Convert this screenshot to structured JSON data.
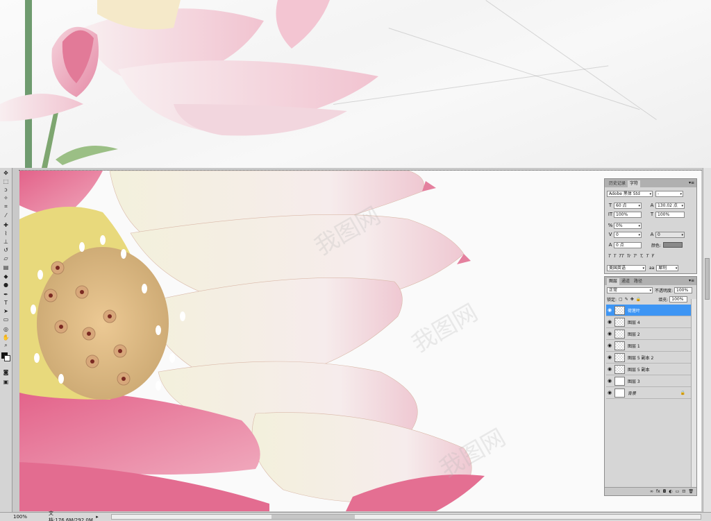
{
  "colors": {
    "selection": "#3d95f4",
    "panel": "#d6d6d6",
    "petal_pink": "#e97a9c",
    "stamen": "#e6cf3c"
  },
  "character_panel": {
    "tabs": [
      "历史记录",
      "字符"
    ],
    "font_family": "Adobe 黑体 Std",
    "font_style": "-",
    "font_size": "60 点",
    "leading": "130.02 点",
    "vertical_scale": "100%",
    "horizontal_scale": "100%",
    "tracking_ratio": "0%",
    "kerning": "0",
    "tracking": "0",
    "baseline_shift": "0 点",
    "color_label": "颜色:",
    "style_buttons": [
      "T",
      "T",
      "TT",
      "Tr",
      "T'",
      "T,",
      "T",
      "Ŧ"
    ],
    "language": "美国英语",
    "aa_label": "aa",
    "antialias": "犀利"
  },
  "layers_panel": {
    "tabs": [
      "图层",
      "通道",
      "路径"
    ],
    "blend_mode": "正常",
    "opacity_label": "不透明度:",
    "opacity": "100%",
    "lock_label": "锁定:",
    "fill_label": "填充:",
    "fill": "100%",
    "layers": [
      {
        "name": "荷莲叶",
        "selected": true,
        "thumb": "checker"
      },
      {
        "name": "图层 4",
        "selected": false,
        "thumb": "checker"
      },
      {
        "name": "图层 2",
        "selected": false,
        "thumb": "checker"
      },
      {
        "name": "图层 1",
        "selected": false,
        "thumb": "checker"
      },
      {
        "name": "图层 5 副本 2",
        "selected": false,
        "thumb": "checker"
      },
      {
        "name": "图层 5 副本",
        "selected": false,
        "thumb": "checker"
      },
      {
        "name": "图层 3",
        "selected": false,
        "thumb": "white"
      },
      {
        "name": "背景",
        "selected": false,
        "thumb": "white",
        "locked": true
      }
    ],
    "bottom_icons": [
      "link-icon",
      "fx-icon",
      "mask-icon",
      "adjust-icon",
      "group-icon",
      "new-layer-icon",
      "trash-icon"
    ]
  },
  "statusbar": {
    "zoom": "100%",
    "doc_info": "文档:176.6M/292.0M",
    "arrow": "▸"
  },
  "watermark": "我图网",
  "tools": [
    "move-tool",
    "marquee-tool",
    "lasso-tool",
    "magic-wand-tool",
    "crop-tool",
    "eyedropper-tool",
    "healing-tool",
    "brush-tool",
    "stamp-tool",
    "history-brush-tool",
    "eraser-tool",
    "gradient-tool",
    "blur-tool",
    "dodge-tool",
    "pen-tool",
    "type-tool",
    "path-select-tool",
    "shape-tool",
    "3d-tool",
    "hand-tool",
    "zoom-tool"
  ]
}
